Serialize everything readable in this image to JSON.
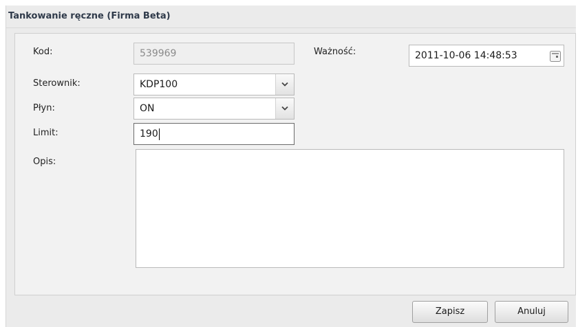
{
  "window": {
    "title": "Tankowanie ręczne (Firma Beta)"
  },
  "form": {
    "kod": {
      "label": "Kod:",
      "value": "539969"
    },
    "waznosc": {
      "label": "Ważność:",
      "value": "2011-10-06 14:48:53",
      "icon": "calendar-icon"
    },
    "sterownik": {
      "label": "Sterownik:",
      "value": "KDP100",
      "icon": "chevron-down-icon"
    },
    "plyn": {
      "label": "Płyn:",
      "value": "ON",
      "icon": "chevron-down-icon"
    },
    "limit": {
      "label": "Limit:",
      "value": "190"
    },
    "opis": {
      "label": "Opis:",
      "value": ""
    }
  },
  "buttons": {
    "save": "Zapisz",
    "cancel": "Anuluj"
  }
}
